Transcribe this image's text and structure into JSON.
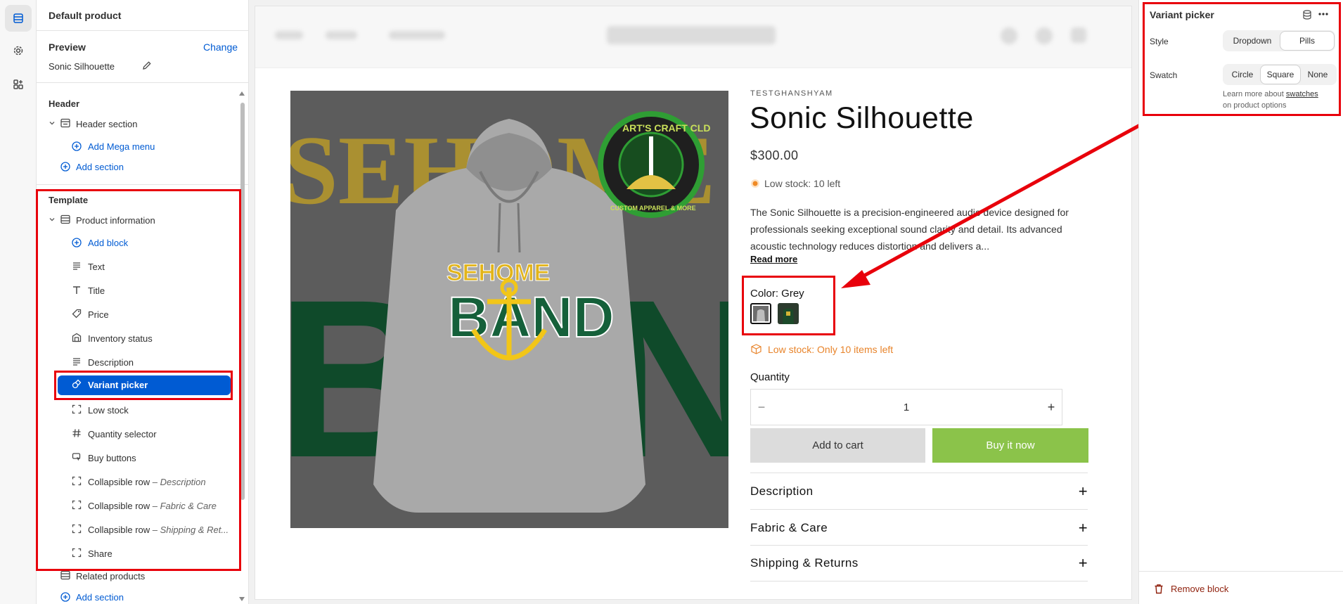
{
  "rail": {
    "icons": [
      "sections-icon",
      "settings-gear-icon",
      "apps-icon"
    ]
  },
  "sidebar": {
    "title": "Default product",
    "preview_label": "Preview",
    "preview_change": "Change",
    "preview_product": "Sonic Silhouette",
    "header_group": "Header",
    "header_section": "Header section",
    "add_mega_menu": "Add Mega menu",
    "add_section_1": "Add section",
    "template_group": "Template",
    "product_information": "Product information",
    "add_block": "Add block",
    "blocks": [
      {
        "label": "Text",
        "icon": "text-icon"
      },
      {
        "label": "Title",
        "icon": "title-icon"
      },
      {
        "label": "Price",
        "icon": "price-tag-icon"
      },
      {
        "label": "Inventory status",
        "icon": "inventory-icon"
      },
      {
        "label": "Description",
        "icon": "text-icon"
      },
      {
        "label": "Variant picker",
        "icon": "variant-icon"
      },
      {
        "label": "Low stock",
        "icon": "block-icon"
      },
      {
        "label": "Quantity selector",
        "icon": "hash-icon"
      },
      {
        "label": "Buy buttons",
        "icon": "cursor-click-icon"
      },
      {
        "label": "Collapsible row",
        "suffix": " – Description",
        "icon": "block-icon"
      },
      {
        "label": "Collapsible row",
        "suffix": " – Fabric & Care",
        "icon": "block-icon"
      },
      {
        "label": "Collapsible row",
        "suffix": " – Shipping & Ret...",
        "icon": "block-icon"
      },
      {
        "label": "Share",
        "icon": "block-icon"
      }
    ],
    "related_products": "Related products",
    "add_section_2": "Add section"
  },
  "store": {
    "vendor": "TESTGHANSHYAM",
    "title": "Sonic Silhouette",
    "price": "$300.00",
    "stock": "Low stock: 10 left",
    "description": "The Sonic Silhouette is a precision-engineered audio device designed for professionals seeking exceptional sound clarity and detail. Its advanced acoustic technology reduces distortion and delivers a...",
    "read_more": "Read more",
    "color_label": "Color: Grey",
    "low_stock_msg": "Low stock: Only 10 items left",
    "quantity_label": "Quantity",
    "quantity_value": "1",
    "minus": "−",
    "plus": "+",
    "add_to_cart": "Add to cart",
    "buy_now": "Buy it now",
    "accordions": [
      "Description",
      "Fabric & Care",
      "Shipping & Returns"
    ],
    "image": {
      "band_top": "SEHOME",
      "band_bottom": "BAND",
      "badge_top": "ART'S CRAFT CLD",
      "badge_bottom": "CUSTOM APPAREL & MORE"
    }
  },
  "panel": {
    "title": "Variant picker",
    "style_label": "Style",
    "style_options": [
      "Dropdown",
      "Pills"
    ],
    "style_selected": "Pills",
    "swatch_label": "Swatch",
    "swatch_options": [
      "Circle",
      "Square",
      "None"
    ],
    "swatch_selected": "Square",
    "help_pre": "Learn more about ",
    "help_link": "swatches",
    "help_post": "on product options",
    "remove_block": "Remove block"
  },
  "colors": {
    "accent": "#005bd3",
    "highlight": "#e8000b",
    "buy_button": "#8bc34a",
    "low_stock": "#e8842b",
    "remove": "#8e1f0b"
  }
}
